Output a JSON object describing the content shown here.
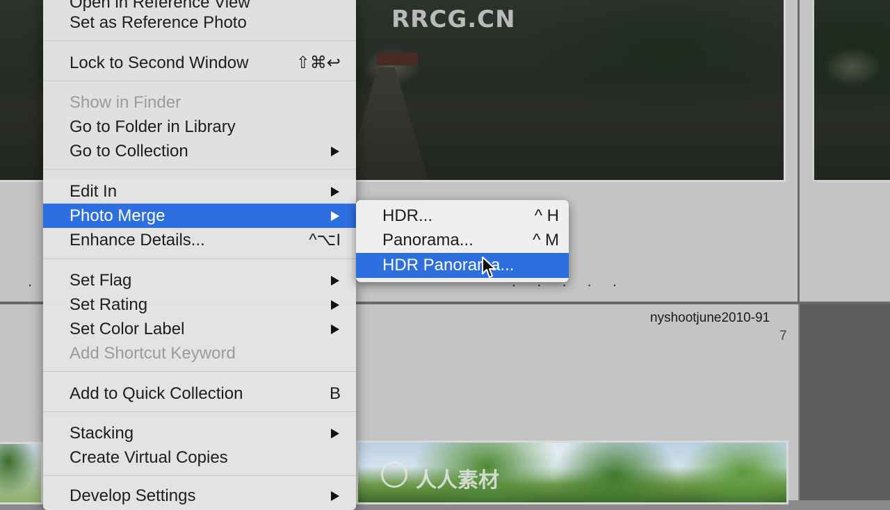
{
  "menu": {
    "items": [
      {
        "label": "Open in Reference View",
        "shortcut": "",
        "submenu": false,
        "disabled": false,
        "highlighted": false
      },
      {
        "label": "Set as Reference Photo",
        "shortcut": "",
        "submenu": false,
        "disabled": false,
        "highlighted": false
      },
      {
        "label": "Lock to Second Window",
        "shortcut": "⇧⌘↩",
        "submenu": false,
        "disabled": false,
        "highlighted": false
      },
      {
        "label": "Show in Finder",
        "shortcut": "",
        "submenu": false,
        "disabled": true,
        "highlighted": false
      },
      {
        "label": "Go to Folder in Library",
        "shortcut": "",
        "submenu": false,
        "disabled": false,
        "highlighted": false
      },
      {
        "label": "Go to Collection",
        "shortcut": "",
        "submenu": true,
        "disabled": false,
        "highlighted": false
      },
      {
        "label": "Edit In",
        "shortcut": "",
        "submenu": true,
        "disabled": false,
        "highlighted": false
      },
      {
        "label": "Photo Merge",
        "shortcut": "",
        "submenu": true,
        "disabled": false,
        "highlighted": true
      },
      {
        "label": "Enhance Details...",
        "shortcut": "^⌥I",
        "submenu": false,
        "disabled": false,
        "highlighted": false
      },
      {
        "label": "Set Flag",
        "shortcut": "",
        "submenu": true,
        "disabled": false,
        "highlighted": false
      },
      {
        "label": "Set Rating",
        "shortcut": "",
        "submenu": true,
        "disabled": false,
        "highlighted": false
      },
      {
        "label": "Set Color Label",
        "shortcut": "",
        "submenu": true,
        "disabled": false,
        "highlighted": false
      },
      {
        "label": "Add Shortcut Keyword",
        "shortcut": "",
        "submenu": false,
        "disabled": true,
        "highlighted": false
      },
      {
        "label": "Add to Quick Collection",
        "shortcut": "B",
        "submenu": false,
        "disabled": false,
        "highlighted": false
      },
      {
        "label": "Stacking",
        "shortcut": "",
        "submenu": true,
        "disabled": false,
        "highlighted": false
      },
      {
        "label": "Create Virtual Copies",
        "shortcut": "",
        "submenu": false,
        "disabled": false,
        "highlighted": false
      },
      {
        "label": "Develop Settings",
        "shortcut": "",
        "submenu": true,
        "disabled": false,
        "highlighted": false
      }
    ]
  },
  "submenu": {
    "items": [
      {
        "label": "HDR...",
        "shortcut": "^ H",
        "highlighted": false
      },
      {
        "label": "Panorama...",
        "shortcut": "^ M",
        "highlighted": false
      },
      {
        "label": "HDR Panorama...",
        "shortcut": "",
        "highlighted": true
      }
    ]
  },
  "grid": {
    "caption_filename": "nyshootjune2010-91",
    "caption_number": "7",
    "dots": ". . . . ."
  },
  "watermark": {
    "top_text": "RRCG.CN",
    "bottom_text": "人人素材"
  },
  "colors": {
    "highlight": "#2e6fe0",
    "menu_bg": "#e6e6e6",
    "disabled_text": "#9b9b9b"
  }
}
